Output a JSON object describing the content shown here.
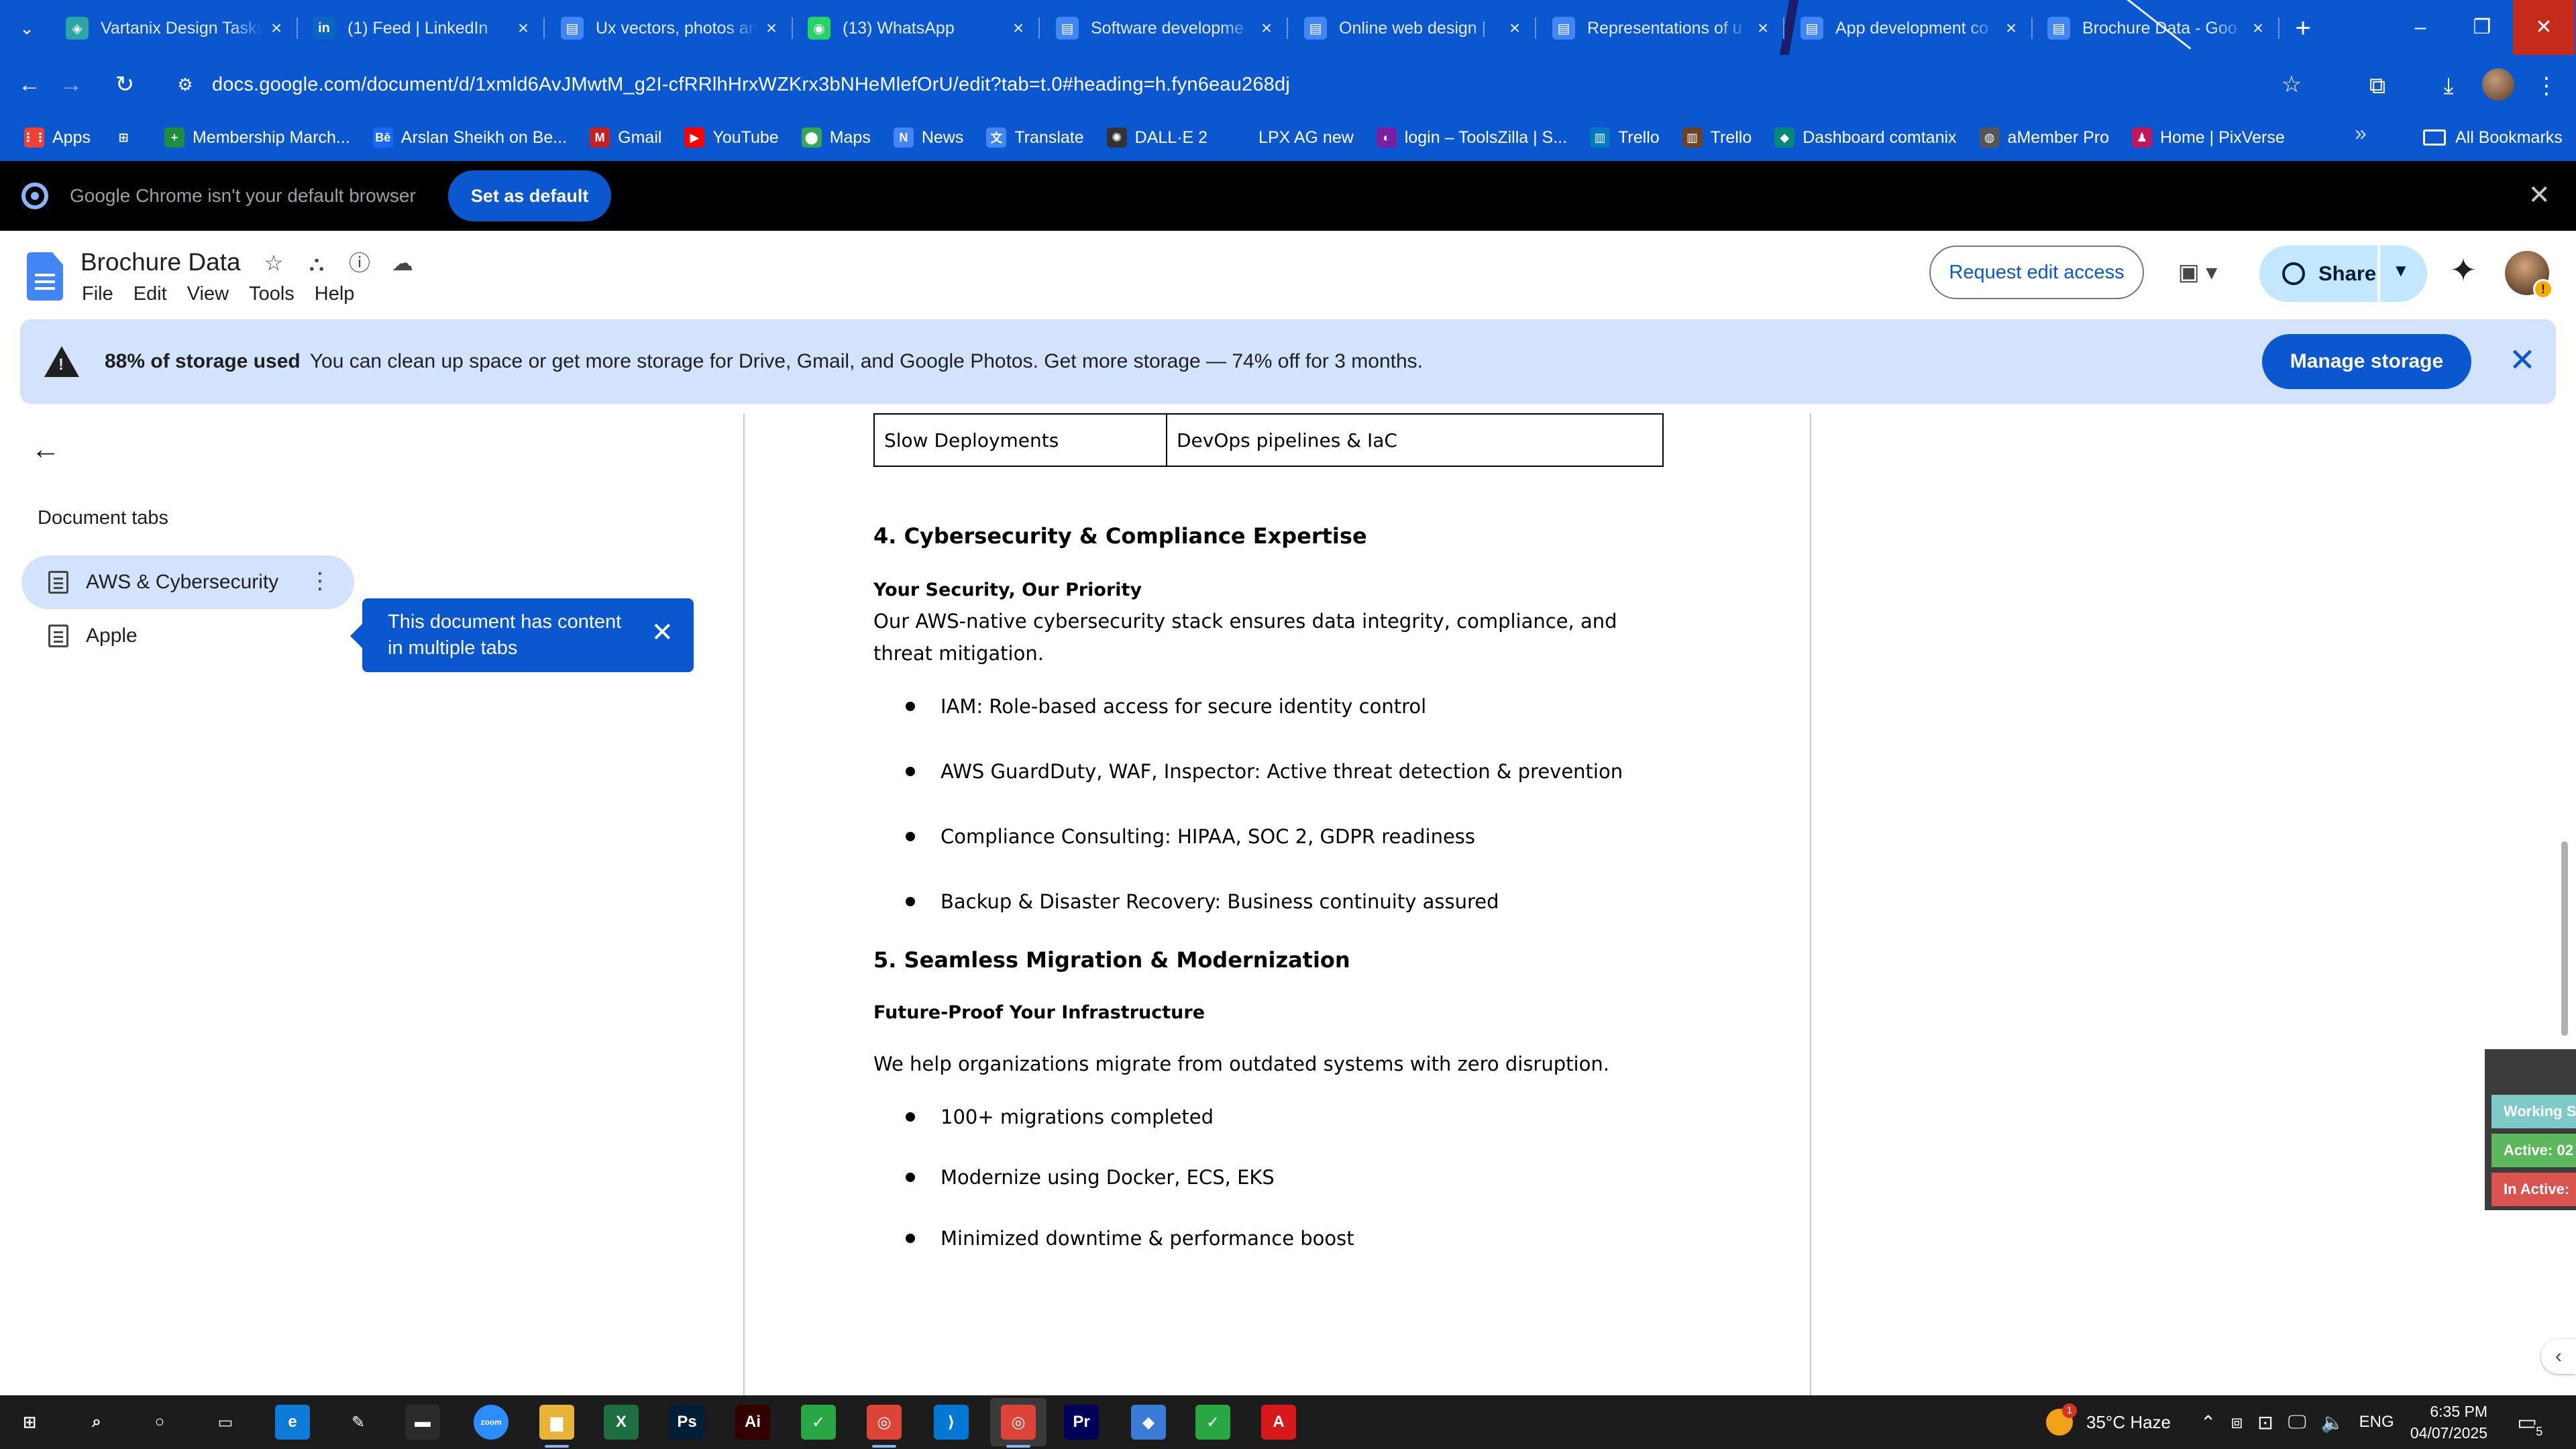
{
  "browser": {
    "tabs": [
      {
        "title": "Vartanix Design Tasks",
        "favicon": "vartanix-logo",
        "color": "#2ca5a5",
        "glyph": "◈"
      },
      {
        "title": "(1) Feed | LinkedIn",
        "favicon": "linkedin-logo",
        "color": "#0a66c2",
        "glyph": "in"
      },
      {
        "title": "Ux vectors, photos an",
        "favicon": "docs-icon",
        "color": "#4285f4",
        "glyph": "▤"
      },
      {
        "title": "(13) WhatsApp",
        "favicon": "whatsapp-logo",
        "color": "#25d366",
        "glyph": "◉"
      },
      {
        "title": "Software developme",
        "favicon": "docs-icon",
        "color": "#4285f4",
        "glyph": "▤"
      },
      {
        "title": "Online web design |",
        "favicon": "docs-icon",
        "color": "#4285f4",
        "glyph": "▤"
      },
      {
        "title": "Representations of u",
        "favicon": "docs-icon",
        "color": "#4285f4",
        "glyph": "▤"
      },
      {
        "title": "App development co",
        "favicon": "docs-icon",
        "color": "#4285f4",
        "glyph": "▤"
      },
      {
        "title": "Brochure Data - Goo",
        "favicon": "docs-icon",
        "color": "#4285f4",
        "glyph": "▤"
      }
    ],
    "url": "docs.google.com/document/d/1xmld6AvJMwtM_g2I-cfRRlhHrxWZKrx3bNHeMlefOrU/edit?tab=t.0#heading=h.fyn6eau268dj",
    "bookmarks": [
      {
        "label": "Apps",
        "icon": "apps-grid-icon",
        "color": "#ea4335",
        "glyph": "⋮⋮"
      },
      {
        "label": "",
        "icon": "grid-icon",
        "color": "#0b57d0",
        "glyph": "⊞"
      },
      {
        "label": "Membership March...",
        "icon": "plus-green-icon",
        "color": "#1e8e3e",
        "glyph": "+"
      },
      {
        "label": "Arslan Sheikh on Be...",
        "icon": "behance-icon",
        "color": "#1769ff",
        "glyph": "Bē"
      },
      {
        "label": "Gmail",
        "icon": "gmail-icon",
        "color": "#c5221f",
        "glyph": "M"
      },
      {
        "label": "YouTube",
        "icon": "youtube-icon",
        "color": "#ff0000",
        "glyph": "▶"
      },
      {
        "label": "Maps",
        "icon": "maps-icon",
        "color": "#34a853",
        "glyph": "⬤"
      },
      {
        "label": "News",
        "icon": "news-icon",
        "color": "#4285f4",
        "glyph": "N"
      },
      {
        "label": "Translate",
        "icon": "translate-icon",
        "color": "#4285f4",
        "glyph": "文"
      },
      {
        "label": "DALL·E 2",
        "icon": "openai-icon",
        "color": "#333333",
        "glyph": "✺"
      },
      {
        "label": "LPX AG new",
        "icon": "blank-icon",
        "color": "#0b57d0",
        "glyph": ""
      },
      {
        "label": "login – ToolsZilla | S...",
        "icon": "toolszilla-icon",
        "color": "#7b1fa2",
        "glyph": "◐"
      },
      {
        "label": "Trello",
        "icon": "trello-icon",
        "color": "#0079bf",
        "glyph": "▥"
      },
      {
        "label": "Trello",
        "icon": "trello-icon",
        "color": "#6b4226",
        "glyph": "▥"
      },
      {
        "label": "Dashboard comtanix",
        "icon": "comtanix-icon",
        "color": "#00897b",
        "glyph": "◆"
      },
      {
        "label": "aMember Pro",
        "icon": "amember-icon",
        "color": "#555555",
        "glyph": "◍"
      },
      {
        "label": "Home | PixVerse",
        "icon": "pixverse-icon",
        "color": "#c2185b",
        "glyph": "♟"
      }
    ],
    "all_bookmarks": "All Bookmarks",
    "default_prompt": {
      "text": "Google Chrome isn't your default browser",
      "button": "Set as default"
    }
  },
  "docs": {
    "title": "Brochure Data",
    "menu": [
      "File",
      "Edit",
      "View",
      "Tools",
      "Help"
    ],
    "request_edit": "Request edit access",
    "share": "Share",
    "user_warning": "!",
    "storage": {
      "bold": "88% of storage used",
      "text": "You can clean up space or get more storage for Drive, Gmail, and Google Photos. Get more storage — 74% off for 3 months.",
      "button": "Manage storage"
    },
    "sidebar": {
      "heading": "Document tabs",
      "tabs": [
        {
          "label": "AWS & Cybersecurity",
          "active": true
        },
        {
          "label": "Apple",
          "active": false
        }
      ],
      "callout": "This document has content in multiple tabs"
    },
    "content": {
      "table_row": [
        "Slow Deployments",
        "DevOps pipelines & IaC"
      ],
      "section4": {
        "heading": "4. Cybersecurity & Compliance Expertise",
        "subheading": "Your Security, Our Priority",
        "paragraph": " Our AWS-native cybersecurity stack ensures data integrity, compliance, and threat mitigation.",
        "bullets": [
          "IAM: Role-based access for secure identity control",
          "AWS GuardDuty, WAF, Inspector: Active threat detection & prevention",
          "Compliance Consulting: HIPAA, SOC 2, GDPR readiness",
          "Backup & Disaster Recovery: Business continuity assured"
        ]
      },
      "section5": {
        "heading": "5. Seamless Migration & Modernization",
        "subheading": "Future-Proof Your Infrastructure",
        "paragraph": "We help organizations migrate from outdated systems with zero disruption.",
        "bullets": [
          "100+ migrations completed",
          "Modernize using Docker, ECS, EKS",
          "Minimized downtime & performance boost"
        ]
      }
    },
    "tracker": [
      {
        "label": "Working S",
        "color": "#7fc9c9"
      },
      {
        "label": "Active: 02",
        "color": "#5cb85c"
      },
      {
        "label": "In Active:",
        "color": "#d9534f"
      }
    ]
  },
  "taskbar": {
    "apps": [
      {
        "name": "windows-start-icon",
        "glyph": "⊞",
        "color": "transparent"
      },
      {
        "name": "search-icon",
        "glyph": "⌕",
        "color": "transparent"
      },
      {
        "name": "cortana-icon",
        "glyph": "○",
        "color": "transparent"
      },
      {
        "name": "task-view-icon",
        "glyph": "▭",
        "color": "transparent"
      },
      {
        "name": "edge-icon",
        "glyph": "e",
        "color": "#0f7bd8"
      },
      {
        "name": "pen-icon",
        "glyph": "✎",
        "color": "transparent"
      },
      {
        "name": "terminal-icon",
        "glyph": "▬",
        "color": "#2b2b2b"
      },
      {
        "name": "zoom-icon",
        "glyph": "zoom",
        "color": "#2d8cff"
      },
      {
        "name": "file-explorer-icon",
        "glyph": "▆",
        "color": "#e8b339"
      },
      {
        "name": "excel-icon",
        "glyph": "X",
        "color": "#1d6f42"
      },
      {
        "name": "photoshop-icon",
        "glyph": "Ps",
        "color": "#001e36"
      },
      {
        "name": "illustrator-icon",
        "glyph": "Ai",
        "color": "#330000"
      },
      {
        "name": "clip-studio-icon",
        "glyph": "✓",
        "color": "#29a745"
      },
      {
        "name": "chrome-icon",
        "glyph": "◎",
        "color": "#db4437"
      },
      {
        "name": "vscode-icon",
        "glyph": "⟩",
        "color": "#0078d4"
      },
      {
        "name": "chrome-active-icon",
        "glyph": "◎",
        "color": "#db4437"
      },
      {
        "name": "premiere-icon",
        "glyph": "Pr",
        "color": "#00005b"
      },
      {
        "name": "app-diamond-icon",
        "glyph": "◆",
        "color": "#3a7bd5"
      },
      {
        "name": "clip-studio-2-icon",
        "glyph": "✓",
        "color": "#29a745"
      },
      {
        "name": "acrobat-icon",
        "glyph": "A",
        "color": "#d7191c"
      }
    ],
    "weather": "35°C  Haze",
    "weather_badge": "1",
    "language": "ENG",
    "time": "6:35 PM",
    "date": "04/07/2025",
    "notifications": "5"
  }
}
